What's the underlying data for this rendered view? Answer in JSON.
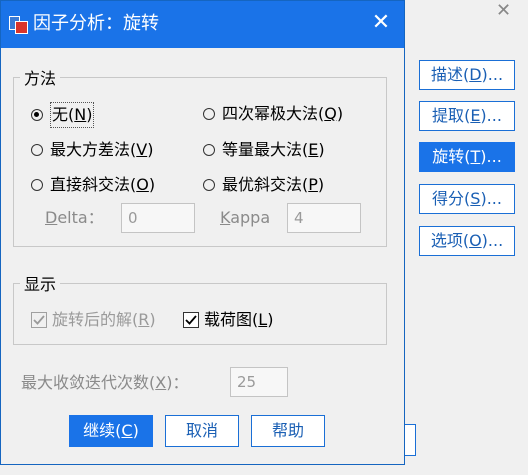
{
  "dialog": {
    "title": "因子分析：旋转",
    "close_glyph": "✕"
  },
  "method": {
    "legend": "方法",
    "options": [
      {
        "label": "无",
        "key": "N",
        "checked": true
      },
      {
        "label": "四次幂极大法",
        "key": "Q",
        "checked": false
      },
      {
        "label": "最大方差法",
        "key": "V",
        "checked": false
      },
      {
        "label": "等量最大法",
        "key": "E",
        "checked": false
      },
      {
        "label": "直接斜交法",
        "key": "O",
        "checked": false
      },
      {
        "label": "最优斜交法",
        "key": "P",
        "checked": false
      }
    ],
    "delta_label": "elta：",
    "delta_key": "D",
    "delta_value": "0",
    "kappa_key": "K",
    "kappa_label": "appa",
    "kappa_value": "4"
  },
  "display": {
    "legend": "显示",
    "rotated_solution": {
      "label": "旋转后的解",
      "key": "R",
      "checked": true,
      "disabled": true
    },
    "loading_plot": {
      "label": "载荷图",
      "key": "L",
      "checked": true
    }
  },
  "iterations": {
    "label": "最大收敛迭代次数",
    "key": "X",
    "suffix": "：",
    "value": "25"
  },
  "buttons": {
    "continue": {
      "label": "继续",
      "key": "C"
    },
    "cancel": "取消",
    "help": "帮助"
  },
  "parent": {
    "close_glyph": "✕",
    "side_buttons": [
      {
        "label": "描述",
        "key": "D",
        "active": false
      },
      {
        "label": "提取",
        "key": "E",
        "active": false
      },
      {
        "label": "旋转",
        "key": "T",
        "active": true
      },
      {
        "label": "得分",
        "key": "S",
        "active": false
      },
      {
        "label": "选项",
        "key": "O",
        "active": false
      }
    ],
    "ellipsis": "..."
  },
  "colors": {
    "accent": "#1a73e8",
    "title_bar": "#1a73e8"
  }
}
